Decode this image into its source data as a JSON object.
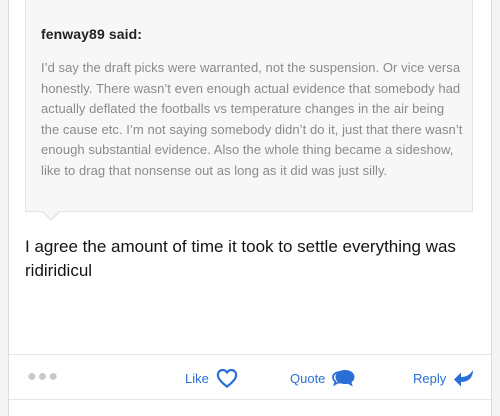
{
  "quote": {
    "author": "fenway89 said:",
    "text": "I’d say the draft picks were warranted, not the suspension. Or vice versa honestly. There wasn’t even enough actual evidence that somebody had actually deflated the footballs vs temperature changes in the air being the cause etc. I’m not saying somebody didn’t do it, just that there wasn’t enough substantial evidence. Also the whole thing became a sideshow, like to drag that nonsense out as long as it did was just silly."
  },
  "post": {
    "body": "I agree the amount of time it took to settle everything was ridiridicul"
  },
  "actions": {
    "more": "●●●",
    "like_label": "Like",
    "quote_label": "Quote",
    "reply_label": "Reply",
    "accent_color": "#2a6fd6"
  },
  "icons": {
    "like": "heart-outline-icon",
    "quote": "speech-bubbles-icon",
    "reply": "reply-arrow-icon",
    "more": "more-dots-icon"
  }
}
